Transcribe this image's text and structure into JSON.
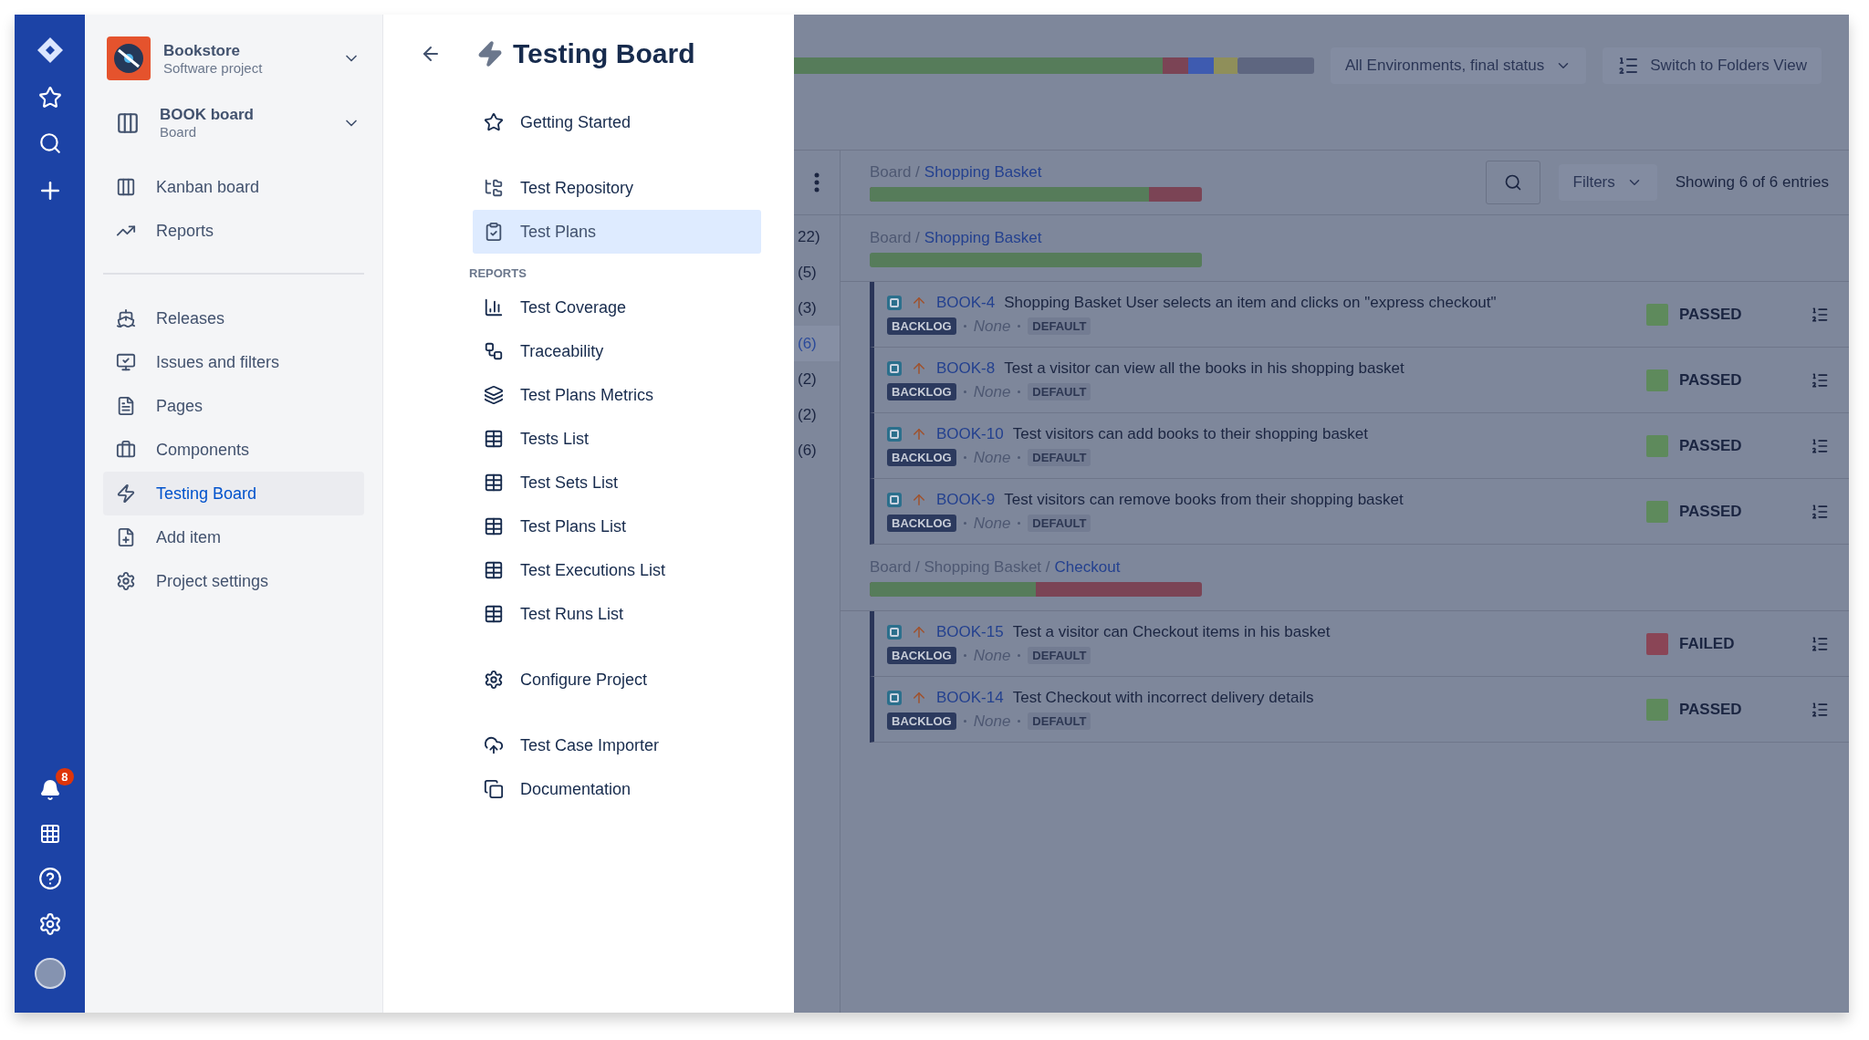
{
  "global_nav": {
    "notification_badge": "8"
  },
  "project": {
    "name": "Bookstore",
    "type": "Software project"
  },
  "board": {
    "name": "BOOK board",
    "type": "Board"
  },
  "sidebar_top": [
    {
      "label": "Kanban board",
      "selected": false
    },
    {
      "label": "Reports",
      "selected": false
    }
  ],
  "sidebar_items": [
    {
      "label": "Releases",
      "selected": false
    },
    {
      "label": "Issues and filters",
      "selected": false
    },
    {
      "label": "Pages",
      "selected": false
    },
    {
      "label": "Components",
      "selected": false
    },
    {
      "label": "Testing Board",
      "selected": true
    },
    {
      "label": "Add item",
      "selected": false
    },
    {
      "label": "Project settings",
      "selected": false
    }
  ],
  "panel": {
    "title": "Testing Board",
    "top_items": [
      {
        "label": "Getting Started",
        "selected": false
      }
    ],
    "main_items": [
      {
        "label": "Test Repository",
        "selected": false
      },
      {
        "label": "Test Plans",
        "selected": true
      }
    ],
    "reports_heading": "REPORTS",
    "reports": [
      {
        "label": "Test Coverage",
        "selected": false
      },
      {
        "label": "Traceability",
        "selected": false
      },
      {
        "label": "Test Plans Metrics",
        "selected": false
      },
      {
        "label": "Tests List",
        "selected": false
      },
      {
        "label": "Test Sets List",
        "selected": false
      },
      {
        "label": "Test Plans List",
        "selected": false
      },
      {
        "label": "Test Executions List",
        "selected": false
      },
      {
        "label": "Test Runs List",
        "selected": false
      }
    ],
    "configure": [
      {
        "label": "Configure Project",
        "selected": false
      }
    ],
    "tools": [
      {
        "label": "Test Case Importer",
        "selected": false
      },
      {
        "label": "Documentation",
        "selected": false
      }
    ]
  },
  "toolbar": {
    "environment_filter": "All Environments, final status",
    "folders_button": "Switch to Folders View"
  },
  "folder_counts": [
    {
      "label": "22)",
      "selected": false
    },
    {
      "label": "(5)",
      "selected": false
    },
    {
      "label": "(3)",
      "selected": false
    },
    {
      "label": "(6)",
      "selected": true
    },
    {
      "label": "(2)",
      "selected": false
    },
    {
      "label": "(2)",
      "selected": false
    },
    {
      "label": "(6)",
      "selected": false
    }
  ],
  "list_header": {
    "path": "Board /",
    "current": "Shopping Basket",
    "level": 0.84,
    "filters": "Filters",
    "entries": "Showing 6 of 6 entries"
  },
  "groups": [
    {
      "path": "Board /",
      "current": "Shopping Basket",
      "level": 1,
      "tests": [
        {
          "key": "BOOK-4",
          "title": "Shopping Basket User selects an item and clicks on \"express checkout\"",
          "status": "BACKLOG",
          "assignee": "None",
          "environment": "DEFAULT",
          "result": {
            "label": "PASSED",
            "color": "#5e8a5c"
          }
        },
        {
          "key": "BOOK-8",
          "title": "Test a visitor can view all the books in his shopping basket",
          "status": "BACKLOG",
          "assignee": "None",
          "environment": "DEFAULT",
          "result": {
            "label": "PASSED",
            "color": "#5e8a5c"
          }
        },
        {
          "key": "BOOK-10",
          "title": "Test visitors can add books to their shopping basket",
          "status": "BACKLOG",
          "assignee": "None",
          "environment": "DEFAULT",
          "result": {
            "label": "PASSED",
            "color": "#5e8a5c"
          }
        },
        {
          "key": "BOOK-9",
          "title": "Test visitors can remove books from their shopping basket",
          "status": "BACKLOG",
          "assignee": "None",
          "environment": "DEFAULT",
          "result": {
            "label": "PASSED",
            "color": "#5e8a5c"
          }
        }
      ]
    },
    {
      "path": "Board / Shopping Basket /",
      "current": "Checkout",
      "level": 0.5,
      "tests": [
        {
          "key": "BOOK-15",
          "title": "Test a visitor can Checkout items in his basket",
          "status": "BACKLOG",
          "assignee": "None",
          "environment": "DEFAULT",
          "result": {
            "label": "FAILED",
            "color": "#8a4556"
          }
        },
        {
          "key": "BOOK-14",
          "title": "Test Checkout with incorrect delivery details",
          "status": "BACKLOG",
          "assignee": "None",
          "environment": "DEFAULT",
          "result": {
            "label": "PASSED",
            "color": "#5e8a5c"
          }
        }
      ]
    }
  ]
}
